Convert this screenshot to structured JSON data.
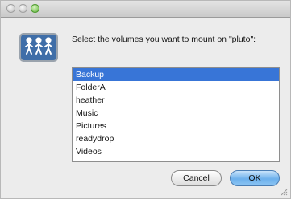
{
  "dialog": {
    "prompt": "Select the volumes you want to mount on \"pluto\":",
    "volumes": [
      "Backup",
      "FolderA",
      "heather",
      "Music",
      "Pictures",
      "readydrop",
      "Videos"
    ],
    "selected_index": 0,
    "cancel_label": "Cancel",
    "ok_label": "OK"
  },
  "icons": {
    "server": "network-server-icon",
    "grip": "resize-grip-icon"
  },
  "colors": {
    "selection": "#3875d7",
    "default_button": "#6cb0ec"
  }
}
